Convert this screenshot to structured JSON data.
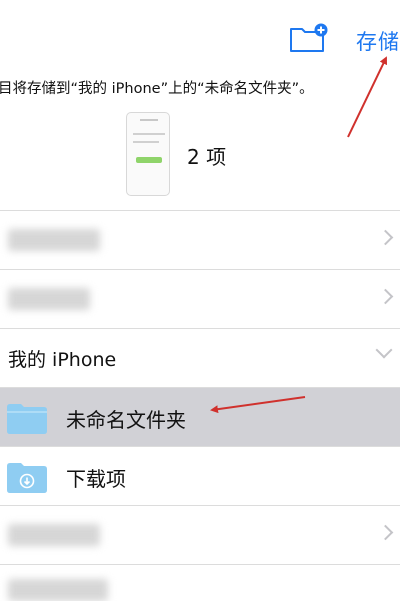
{
  "header": {
    "save_label": "存储",
    "info_text": "目将存储到“我的 iPhone”上的“未命名文件夹”。",
    "item_count": "2 项"
  },
  "locations": [
    {
      "label_blurred": true
    },
    {
      "label_blurred": true
    },
    {
      "label": "我的 iPhone",
      "expanded": true
    },
    {
      "label": "未命名文件夹",
      "selected": true
    },
    {
      "label": "下载项"
    },
    {
      "label_blurred": true
    }
  ],
  "colors": {
    "accent": "#1e78f0",
    "folder": "#8fcdf2",
    "selected_row": "#d1d1d6",
    "annotation_arrow": "#d0312d"
  }
}
